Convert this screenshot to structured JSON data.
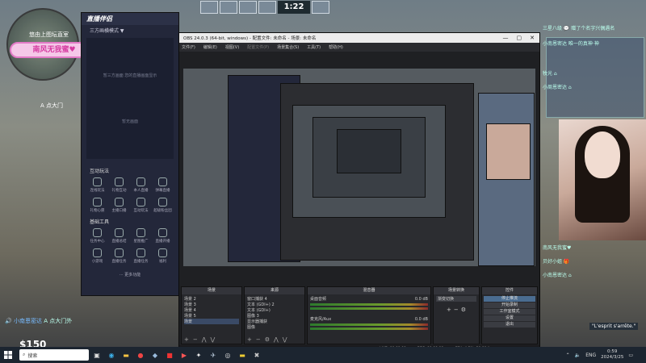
{
  "game": {
    "stream_badge": "悠由上图坛直室",
    "nickname": "南风无我蜜♥",
    "area_label": "A 点大门",
    "timer": "1:22",
    "cash": "$150",
    "killfeed_name": "小南恩密达",
    "killfeed_text": "A 点大门外"
  },
  "streamapp": {
    "title": "直播伴侣",
    "mode_label": "三方画横模式 ▼",
    "empty_hint": "暂三方画面 您的直播画面显示",
    "empty_label": "暂无画面",
    "section_interact": "互动玩法",
    "interact_items": [
      "连线玩法",
      "礼物互动",
      "本人直播",
      "弹幕直播",
      "礼物心愿",
      "主播口播",
      "互动玩法",
      "超级粉丝团"
    ],
    "section_tools": "基础工具",
    "tool_items": [
      "任务中心",
      "直播总结",
      "星图推广",
      "直播开播",
      "小游戏",
      "直播任务",
      "直播任务",
      "福利"
    ],
    "more": "··· 更多功能"
  },
  "obs": {
    "title": "OBS 24.0.3 (64-bit, windows) - 配置文件: 未命名 - 场景: 未命名",
    "ctrl_min": "—",
    "ctrl_max": "▢",
    "ctrl_close": "✕",
    "menu": [
      "文件(F)",
      "编辑(E)",
      "视图(V)",
      "配置文件(P)",
      "场景集合(S)",
      "工具(T)",
      "帮助(H)"
    ],
    "menu_disabled": [
      3
    ],
    "docks": {
      "scenes": {
        "title": "场景",
        "items": [
          "场景 2",
          "场景 3",
          "场景 4",
          "场景 5",
          "场景"
        ],
        "selected": 4
      },
      "sources": {
        "title": "来源",
        "items": [
          "窗口捕获 4",
          "文本 (GDI+) 2",
          "文本 (GDI+)",
          "图像 3",
          "显示器捕获",
          "图像"
        ]
      },
      "mixer": {
        "title": "混音器",
        "tracks": [
          {
            "name": "桌面音频",
            "level": "0.0 dB"
          },
          {
            "name": "麦克风/Aux",
            "level": "0.0 dB"
          }
        ]
      },
      "transitions": {
        "title": "场景转换",
        "type": "渐变切换"
      },
      "controls": {
        "title": "控件",
        "buttons": [
          "停止推流",
          "开始录制",
          "工作室模式",
          "设置",
          "退出"
        ],
        "active": 0
      }
    },
    "status": {
      "live": "LIVE: 00:00:00",
      "rec": "REC: 00:00:00",
      "cpu": "CPU: 4.3%, 30.00 fps"
    }
  },
  "chat": {
    "lines": [
      "三星八级 💬 赠了个名字兴偶遇名",
      "小南恩密达 唯一的真神·神",
      "牧光 ⌂",
      "小周恩密达 ⌂",
      "南风无我蜜♥",
      "贝好小姐 🎁",
      "小南恩密达 ⌂"
    ],
    "esprit": "\"L'esprit s'arrête.\""
  },
  "taskbar": {
    "search_placeholder": "搜索",
    "icons": [
      "task-view",
      "edge",
      "file-explorer",
      "chrome",
      "steam",
      "app-red",
      "app-red2",
      "csgo",
      "steam2",
      "obs",
      "app-yellow",
      "app-dark"
    ],
    "lang": "ENG",
    "time": "0:59",
    "date": "2024/3/25"
  }
}
